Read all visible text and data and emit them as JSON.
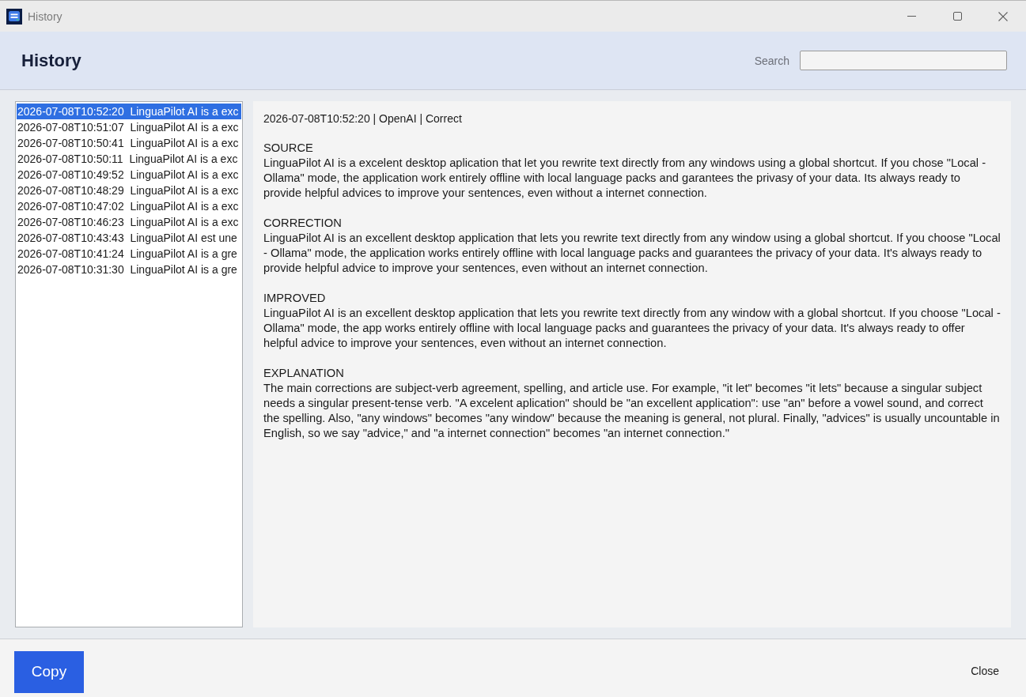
{
  "window": {
    "title": "History"
  },
  "header": {
    "title": "History",
    "search": {
      "label": "Search"
    }
  },
  "history_list": {
    "items": [
      {
        "timestamp": "2026-07-08T10:52:20",
        "preview": "LinguaPilot AI is a exc",
        "selected": true
      },
      {
        "timestamp": "2026-07-08T10:51:07",
        "preview": "LinguaPilot AI is a exc",
        "selected": false
      },
      {
        "timestamp": "2026-07-08T10:50:41",
        "preview": "LinguaPilot AI is a exc",
        "selected": false
      },
      {
        "timestamp": "2026-07-08T10:50:11",
        "preview": "LinguaPilot AI is a exc",
        "selected": false
      },
      {
        "timestamp": "2026-07-08T10:49:52",
        "preview": "LinguaPilot AI is a exc",
        "selected": false
      },
      {
        "timestamp": "2026-07-08T10:48:29",
        "preview": "LinguaPilot AI is a exc",
        "selected": false
      },
      {
        "timestamp": "2026-07-08T10:47:02",
        "preview": "LinguaPilot AI is a exc",
        "selected": false
      },
      {
        "timestamp": "2026-07-08T10:46:23",
        "preview": "LinguaPilot AI is a exc",
        "selected": false
      },
      {
        "timestamp": "2026-07-08T10:43:43",
        "preview": "LinguaPilot AI est une",
        "selected": false
      },
      {
        "timestamp": "2026-07-08T10:41:24",
        "preview": "LinguaPilot AI is a gre",
        "selected": false
      },
      {
        "timestamp": "2026-07-08T10:31:30",
        "preview": "LinguaPilot AI is a gre",
        "selected": false
      }
    ]
  },
  "detail": {
    "meta": "2026-07-08T10:52:20 | OpenAI | Correct",
    "sections": [
      {
        "heading": "SOURCE",
        "text": "LinguaPilot AI is a excelent desktop aplication that let you rewrite text directly from any windows using a global shortcut. If you chose \"Local - Ollama\" mode, the application work entirely offline with local language packs and garantees the privasy of your data. Its always ready to provide helpful advices to improve your sentences, even without a internet connection."
      },
      {
        "heading": "CORRECTION",
        "text": "LinguaPilot AI is an excellent desktop application that lets you rewrite text directly from any window using a global shortcut. If you choose \"Local - Ollama\" mode, the application works entirely offline with local language packs and guarantees the privacy of your data. It's always ready to provide helpful advice to improve your sentences, even without an internet connection."
      },
      {
        "heading": "IMPROVED",
        "text": "LinguaPilot AI is an excellent desktop application that lets you rewrite text directly from any window with a global shortcut. If you choose \"Local - Ollama\" mode, the app works entirely offline with local language packs and guarantees the privacy of your data. It's always ready to offer helpful advice to improve your sentences, even without an internet connection."
      },
      {
        "heading": "EXPLANATION",
        "text": "The main corrections are subject-verb agreement, spelling, and article use. For example, \"it let\" becomes \"it lets\" because a singular subject needs a singular present-tense verb. \"A excelent aplication\" should be \"an excellent application\": use \"an\" before a vowel sound, and correct the spelling. Also, \"any windows\" becomes \"any window\" because the meaning is general, not plural. Finally, \"advices\" is usually uncountable in English, so we say \"advice,\" and \"a internet connection\" becomes \"an internet connection.\""
      }
    ]
  },
  "footer": {
    "buttons": [
      {
        "label": "Copy",
        "kind": "primary"
      },
      {
        "label": "Close",
        "kind": "flat"
      }
    ]
  }
}
